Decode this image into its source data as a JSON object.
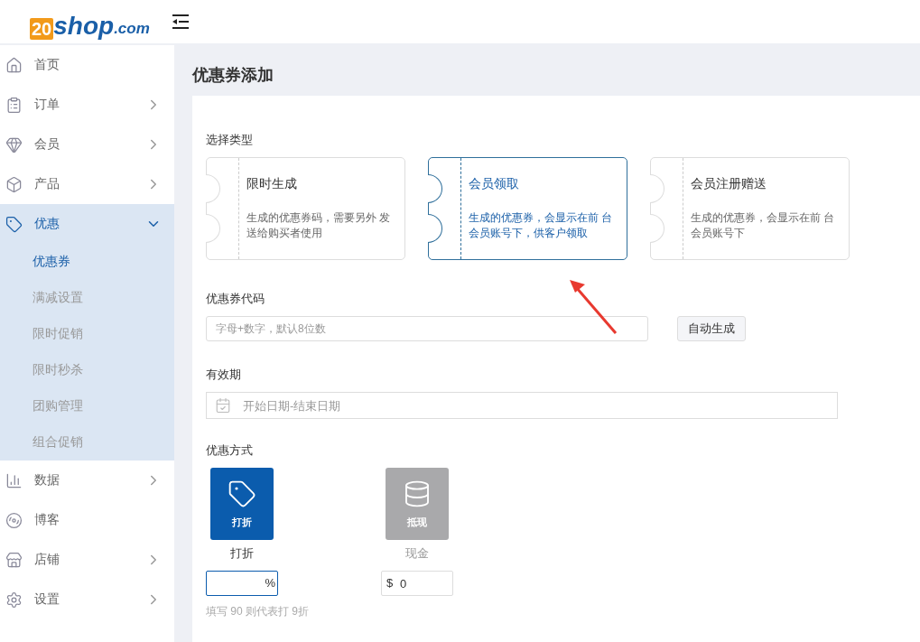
{
  "header": {
    "logo": {
      "badge": "20",
      "name": "shop",
      "suffix": ".com"
    }
  },
  "sidebar": {
    "items": [
      {
        "label": "首页",
        "selected": false
      },
      {
        "label": "订单",
        "selected": false,
        "expanded": false
      },
      {
        "label": "会员",
        "selected": false,
        "expanded": false
      },
      {
        "label": "产品",
        "selected": false,
        "expanded": false
      },
      {
        "label": "优惠",
        "selected": true,
        "expanded": true,
        "children": [
          {
            "label": "优惠券",
            "selected": true
          },
          {
            "label": "满减设置",
            "selected": false
          },
          {
            "label": "限时促销",
            "selected": false
          },
          {
            "label": "限时秒杀",
            "selected": false
          },
          {
            "label": "团购管理",
            "selected": false
          },
          {
            "label": "组合促销",
            "selected": false
          }
        ]
      },
      {
        "label": "数据",
        "selected": false,
        "expanded": false
      },
      {
        "label": "博客",
        "selected": false
      },
      {
        "label": "店铺",
        "selected": false,
        "expanded": false
      },
      {
        "label": "设置",
        "selected": false,
        "expanded": false
      }
    ]
  },
  "page": {
    "title": "优惠券添加"
  },
  "form": {
    "type_section": {
      "label": "选择类型",
      "options": [
        {
          "title": "限时生成",
          "description": "生成的优惠券码，需要另外 发送给购买者使用",
          "selected": false
        },
        {
          "title": "会员领取",
          "description": "生成的优惠券，会显示在前 台会员账号下，供客户领取",
          "selected": true
        },
        {
          "title": "会员注册赠送",
          "description": "生成的优惠券，会显示在前 台会员账号下",
          "selected": false
        }
      ]
    },
    "code_section": {
      "label": "优惠券代码",
      "placeholder": "字母+数字，默认8位数",
      "button": "自动生成"
    },
    "validity_section": {
      "label": "有效期",
      "placeholder": "开始日期-结束日期"
    },
    "method_section": {
      "label": "优惠方式",
      "options": [
        {
          "kind": "discount",
          "tile_label": "打折",
          "caption": "打折",
          "selected": true,
          "unit": "%"
        },
        {
          "kind": "cash",
          "tile_label": "抵现",
          "caption": "现金",
          "selected": false,
          "unit": "$",
          "value": "0"
        }
      ],
      "hint": "填写 90 则代表打 9折"
    }
  }
}
